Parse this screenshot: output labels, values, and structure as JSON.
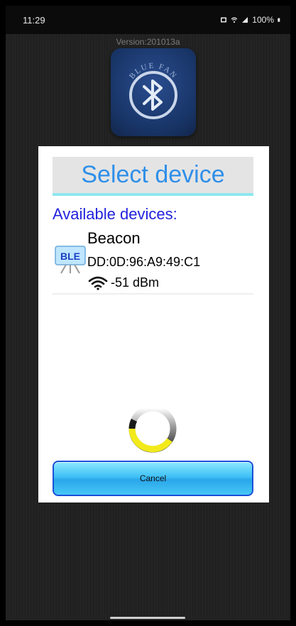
{
  "status_bar": {
    "time": "11:29",
    "battery": "100%",
    "icons": [
      "image-icon",
      "wifi-icon",
      "signal-icon",
      "battery-icon"
    ]
  },
  "app": {
    "version": "Version:201013a",
    "logo_text": "BLUE FAN",
    "logo_icon": "bluetooth-icon"
  },
  "dialog": {
    "title": "Select device",
    "available_label": "Available devices:",
    "devices": [
      {
        "name": "Beacon",
        "address": "DD:0D:96:A9:49:C1",
        "rssi": "-51 dBm",
        "icon": "ble-icon",
        "icon_label": "BLE"
      }
    ],
    "cancel_label": "Cancel"
  },
  "colors": {
    "title_text": "#2f8fe9",
    "available_label": "#2222dd",
    "title_underline": "#8ee6ee",
    "cancel_button": "#3fc0f5",
    "spinner_accent": "#f2ea1a"
  }
}
